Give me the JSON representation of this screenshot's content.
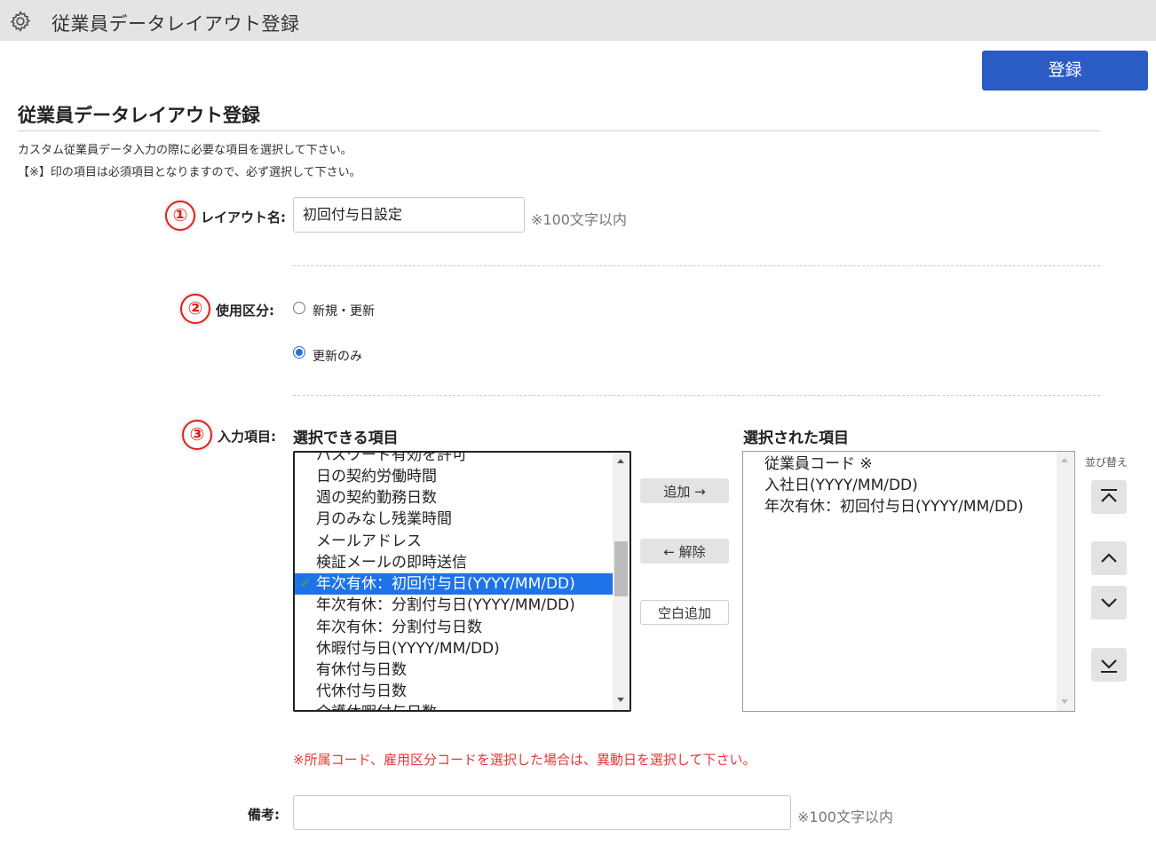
{
  "topbar": {
    "title": "従業員データレイアウト登録",
    "icon": "gear-icon"
  },
  "register_button": "登録",
  "page_title": "従業員データレイアウト登録",
  "description": [
    "カスタム従業員データ入力の際に必要な項目を選択して下さい。",
    "【※】印の項目は必須項目となりますので、必ず選択して下さい。"
  ],
  "layout_name": {
    "badge": "①",
    "label": "レイアウト名:",
    "value": "初回付与日設定",
    "hint": "※100文字以内"
  },
  "usage": {
    "badge": "②",
    "label": "使用区分:",
    "options": [
      {
        "label": "新規・更新",
        "checked": false
      },
      {
        "label": "更新のみ",
        "checked": true
      }
    ]
  },
  "input_items": {
    "badge": "③",
    "label": "入力項目:",
    "available_header": "選択できる項目",
    "selected_header": "選択された項目",
    "available": [
      "パスワード有効を許可",
      "日の契約労働時間",
      "週の契約勤務日数",
      "月のみなし残業時間",
      "メールアドレス",
      "検証メールの即時送信",
      "年次有休：初回付与日(YYYY/MM/DD)",
      "年次有休：分割付与日(YYYY/MM/DD)",
      "年次有休：分割付与日数",
      "休暇付与日(YYYY/MM/DD)",
      "有休付与日数",
      "代休付与日数",
      "介護休暇付与日数"
    ],
    "selected_index": 6,
    "chosen": [
      "従業員コード ※",
      "入社日(YYYY/MM/DD)",
      "年次有休：初回付与日(YYYY/MM/DD)"
    ],
    "add_button": "追加 →",
    "remove_button": "← 解除",
    "blank_button": "空白追加",
    "sort_label": "並び替え",
    "sort_buttons": [
      "move-top",
      "move-up",
      "move-down",
      "move-bottom"
    ]
  },
  "warning": "※所属コード、雇用区分コードを選択した場合は、異動日を選択して下さい。",
  "remarks": {
    "label": "備考:",
    "value": "",
    "hint": "※100文字以内"
  },
  "colors": {
    "accent": "#2b5cc4",
    "selection": "#1e73e8",
    "warning": "#e53935",
    "badge": "#e02020"
  }
}
